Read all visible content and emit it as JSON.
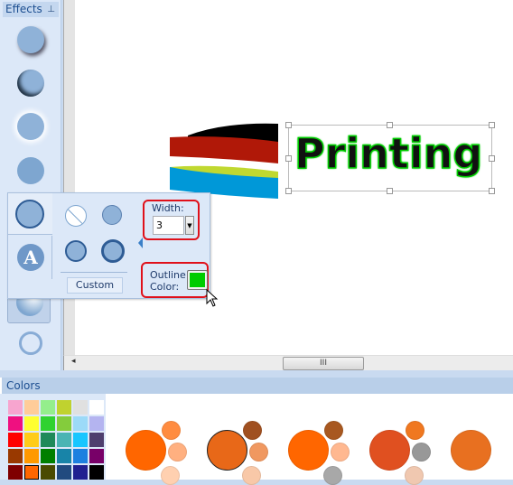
{
  "effects": {
    "title": "Effects",
    "pin_icon": "pin-icon"
  },
  "canvas": {
    "text": "Printing",
    "text_fill": "#111111",
    "text_outline": "#00cc00",
    "logo_colors": [
      "#000000",
      "#b01808",
      "#c0d830",
      "#0098d8"
    ]
  },
  "popup": {
    "width_label": "Width:",
    "width_value": "3",
    "outline_label_1": "Outline",
    "outline_label_2": "Color:",
    "outline_color": "#00cc00",
    "custom_label": "Custom"
  },
  "scrollbar": {
    "thumb_label": "III"
  },
  "colors": {
    "title": "Colors",
    "selected": "#ff6600",
    "palette": [
      [
        "#f7a5cf",
        "#ffcc99",
        "#94ee8c",
        "#c0d22f",
        "#e0e0e0",
        "#ffffff"
      ],
      [
        "#ef1080",
        "#ffff30",
        "#30d230",
        "#84cc3c",
        "#9cdaf8",
        "#b4b4f0"
      ],
      [
        "#ff0000",
        "#ffcc18",
        "#1f8a5a",
        "#4ab4b4",
        "#18c6ff",
        "#4f3f6e"
      ],
      [
        "#993900",
        "#ff9900",
        "#007f00",
        "#1884a8",
        "#1c80e0",
        "#780068"
      ],
      [
        "#7f0000",
        "#ff6600",
        "#4a4a00",
        "#214a7f",
        "#202090",
        "#000000"
      ]
    ],
    "schemes": [
      [
        "#ff6600",
        "#ff8c40",
        "#ffb080",
        "#ffd0b0"
      ],
      [
        "#e86818",
        "#a05020",
        "#f09860",
        "#f8c8a8"
      ],
      [
        "#ff6600",
        "#a85820",
        "#ffb890",
        "#a8a8a8"
      ],
      [
        "#e05020",
        "#f07820",
        "#989898",
        "#f0c8b0"
      ],
      [
        "#e87020",
        "#000000",
        "#000000",
        "#000000"
      ]
    ]
  }
}
